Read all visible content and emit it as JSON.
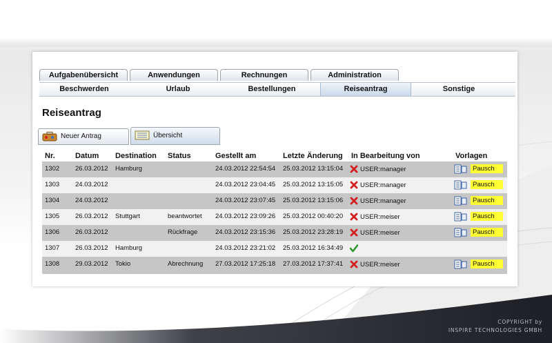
{
  "nav": {
    "top_tabs": [
      "Aufgabenübersicht",
      "Anwendungen",
      "Rechnungen",
      "Administration"
    ],
    "sub_tabs": [
      "Beschwerden",
      "Urlaub",
      "Bestellungen",
      "Reiseantrag",
      "Sonstige"
    ],
    "active_sub_tab": "Reiseantrag"
  },
  "page": {
    "title": "Reiseantrag"
  },
  "actions": {
    "new_label": "Neuer Antrag",
    "overview_label": "Übersicht"
  },
  "table": {
    "headers": {
      "nr": "Nr.",
      "datum": "Datum",
      "destination": "Destination",
      "status": "Status",
      "gestellt": "Gestellt am",
      "aenderung": "Letzte Änderung",
      "bearbeitung": "In Bearbeitung von",
      "vorlagen": "Vorlagen"
    },
    "rows": [
      {
        "nr": "1302",
        "datum": "26.03.2012",
        "destination": "Hamburg",
        "status": "",
        "gestellt": "24.03.2012 22:54:54",
        "aenderung": "25.03.2012 13:15:04",
        "bearbeitung": "USER:manager",
        "state": "x",
        "vorlage": "Pausch"
      },
      {
        "nr": "1303",
        "datum": "24.03.2012",
        "destination": "",
        "status": "",
        "gestellt": "24.03.2012 23:04:45",
        "aenderung": "25.03.2012 13:15:05",
        "bearbeitung": "USER:manager",
        "state": "x",
        "vorlage": "Pausch"
      },
      {
        "nr": "1304",
        "datum": "24.03.2012",
        "destination": "",
        "status": "",
        "gestellt": "24.03.2012 23:07:45",
        "aenderung": "25.03.2012 13:15:06",
        "bearbeitung": "USER:manager",
        "state": "x",
        "vorlage": "Pausch"
      },
      {
        "nr": "1305",
        "datum": "26.03.2012",
        "destination": "Stuttgart",
        "status": "beantwortet",
        "gestellt": "24.03.2012 23:09:26",
        "aenderung": "25.03.2012 00:40:20",
        "bearbeitung": "USER:meiser",
        "state": "x",
        "vorlage": "Pausch"
      },
      {
        "nr": "1306",
        "datum": "26.03.2012",
        "destination": "",
        "status": "Rückfrage",
        "gestellt": "24.03.2012 23:15:36",
        "aenderung": "25.03.2012 23:28:19",
        "bearbeitung": "USER:meiser",
        "state": "x",
        "vorlage": "Pausch"
      },
      {
        "nr": "1307",
        "datum": "26.03.2012",
        "destination": "Hamburg",
        "status": "",
        "gestellt": "24.03.2012 23:21:02",
        "aenderung": "25.03.2012 16:34:49",
        "bearbeitung": "",
        "state": "check",
        "vorlage": ""
      },
      {
        "nr": "1308",
        "datum": "29.03.2012",
        "destination": "Tokio",
        "status": "Abrechnung",
        "gestellt": "27.03.2012 17:25:18",
        "aenderung": "27.03.2012 17:37:41",
        "bearbeitung": "USER:meiser",
        "state": "x",
        "vorlage": "Pausch"
      }
    ]
  },
  "footer": {
    "copyright_line1": "COPYRIGHT by",
    "copyright_line2": "INSPIRE TECHNOLOGIES GMBH"
  },
  "icons": {
    "x_mark": "x-icon",
    "check": "check-icon",
    "document": "document-icon",
    "new_request": "suitcase-icon",
    "overview": "list-icon"
  },
  "colors": {
    "highlight": "#ffff33",
    "row_dark": "#c6c6c6",
    "row_light": "#f1f1f1",
    "x_red": "#d21f1f",
    "check_green": "#2e9a2e"
  }
}
